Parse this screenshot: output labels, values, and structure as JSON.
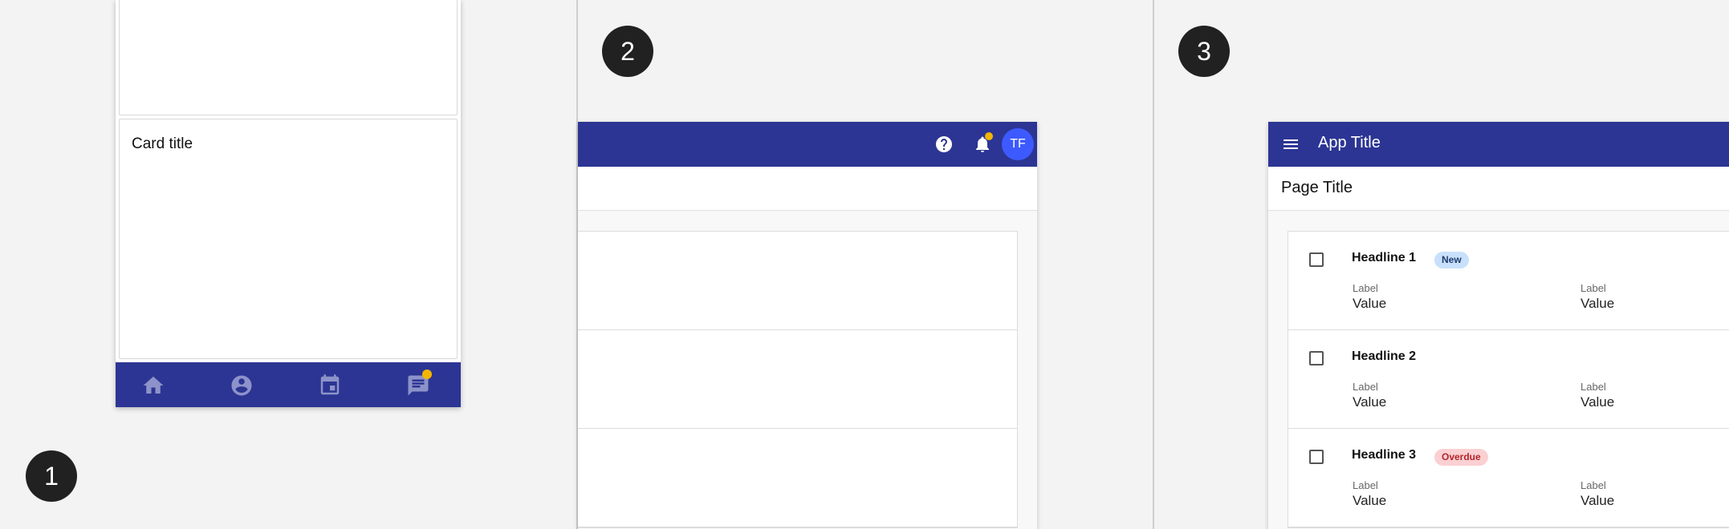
{
  "steps": [
    "1",
    "2",
    "3"
  ],
  "panel1": {
    "card_title": "Card title",
    "bottom_nav": [
      {
        "icon": "home-icon"
      },
      {
        "icon": "account-icon"
      },
      {
        "icon": "calendar-icon"
      },
      {
        "icon": "messages-icon",
        "has_notification": true
      }
    ]
  },
  "panel2": {
    "avatar_initials": "TF",
    "icons": [
      "help-icon",
      "notifications-icon"
    ]
  },
  "panel3": {
    "app_title": "App Title",
    "page_title": "Page Title",
    "items": [
      {
        "headline": "Headline 1",
        "badge": "New",
        "fields": [
          {
            "label": "Label",
            "value": "Value"
          },
          {
            "label": "Label",
            "value": "Value"
          }
        ]
      },
      {
        "headline": "Headline 2",
        "badge": "",
        "fields": [
          {
            "label": "Label",
            "value": "Value"
          },
          {
            "label": "Label",
            "value": "Value"
          }
        ]
      },
      {
        "headline": "Headline 3",
        "badge": "Overdue",
        "fields": [
          {
            "label": "Label",
            "value": "Value"
          },
          {
            "label": "Label",
            "value": "Value"
          }
        ]
      }
    ]
  },
  "colors": {
    "app_bar": "#2c3593",
    "avatar": "#3d5afe",
    "notification_dot": "#f2b600",
    "step_badge": "#212121",
    "badge_new": "#c8e0fb",
    "badge_overdue": "#fbd0d2"
  }
}
